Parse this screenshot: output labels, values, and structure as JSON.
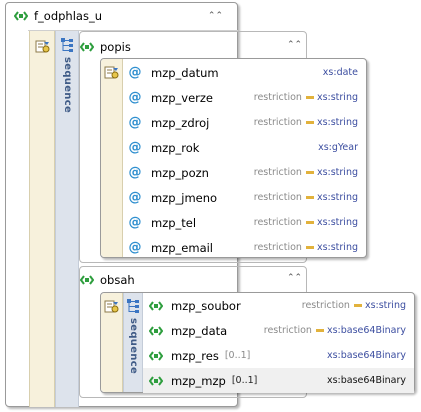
{
  "root": {
    "name": "f_odphlas_u"
  },
  "popis": {
    "name": "popis",
    "attributes": [
      {
        "name": "mzp_datum",
        "restriction": "",
        "type": "xs:date"
      },
      {
        "name": "mzp_verze",
        "restriction": "restriction",
        "type": "xs:string"
      },
      {
        "name": "mzp_zdroj",
        "restriction": "restriction",
        "type": "xs:string"
      },
      {
        "name": "mzp_rok",
        "restriction": "",
        "type": "xs:gYear"
      },
      {
        "name": "mzp_pozn",
        "restriction": "restriction",
        "type": "xs:string"
      },
      {
        "name": "mzp_jmeno",
        "restriction": "restriction",
        "type": "xs:string"
      },
      {
        "name": "mzp_tel",
        "restriction": "restriction",
        "type": "xs:string"
      },
      {
        "name": "mzp_email",
        "restriction": "restriction",
        "type": "xs:string"
      }
    ]
  },
  "sequence_label": "sequence",
  "obsah": {
    "name": "obsah",
    "elements": [
      {
        "name": "mzp_soubor",
        "occurrence": "",
        "restriction": "restriction",
        "type": "xs:string"
      },
      {
        "name": "mzp_data",
        "occurrence": "",
        "restriction": "restriction",
        "type": "xs:base64Binary"
      },
      {
        "name": "mzp_res",
        "occurrence": "[0..1]",
        "restriction": "",
        "type": "xs:base64Binary"
      },
      {
        "name": "mzp_mzp",
        "occurrence": "[0..1]",
        "restriction": "",
        "type": "xs:base64Binary"
      }
    ]
  },
  "icons": {
    "element": "element-icon",
    "attribute": "attribute-at-icon",
    "sequence": "sequence-icon",
    "attributes_group": "attributes-icon",
    "collapse": "chevron-up-icon"
  },
  "colors": {
    "element_icon": "#2e9e3e",
    "attribute_icon": "#2f8fcf",
    "type_text": "#3c4ea0",
    "restriction_marker": "#e2b23c",
    "sequence_bar": "#dde3ec",
    "attr_panel": "#f7f1dc"
  }
}
